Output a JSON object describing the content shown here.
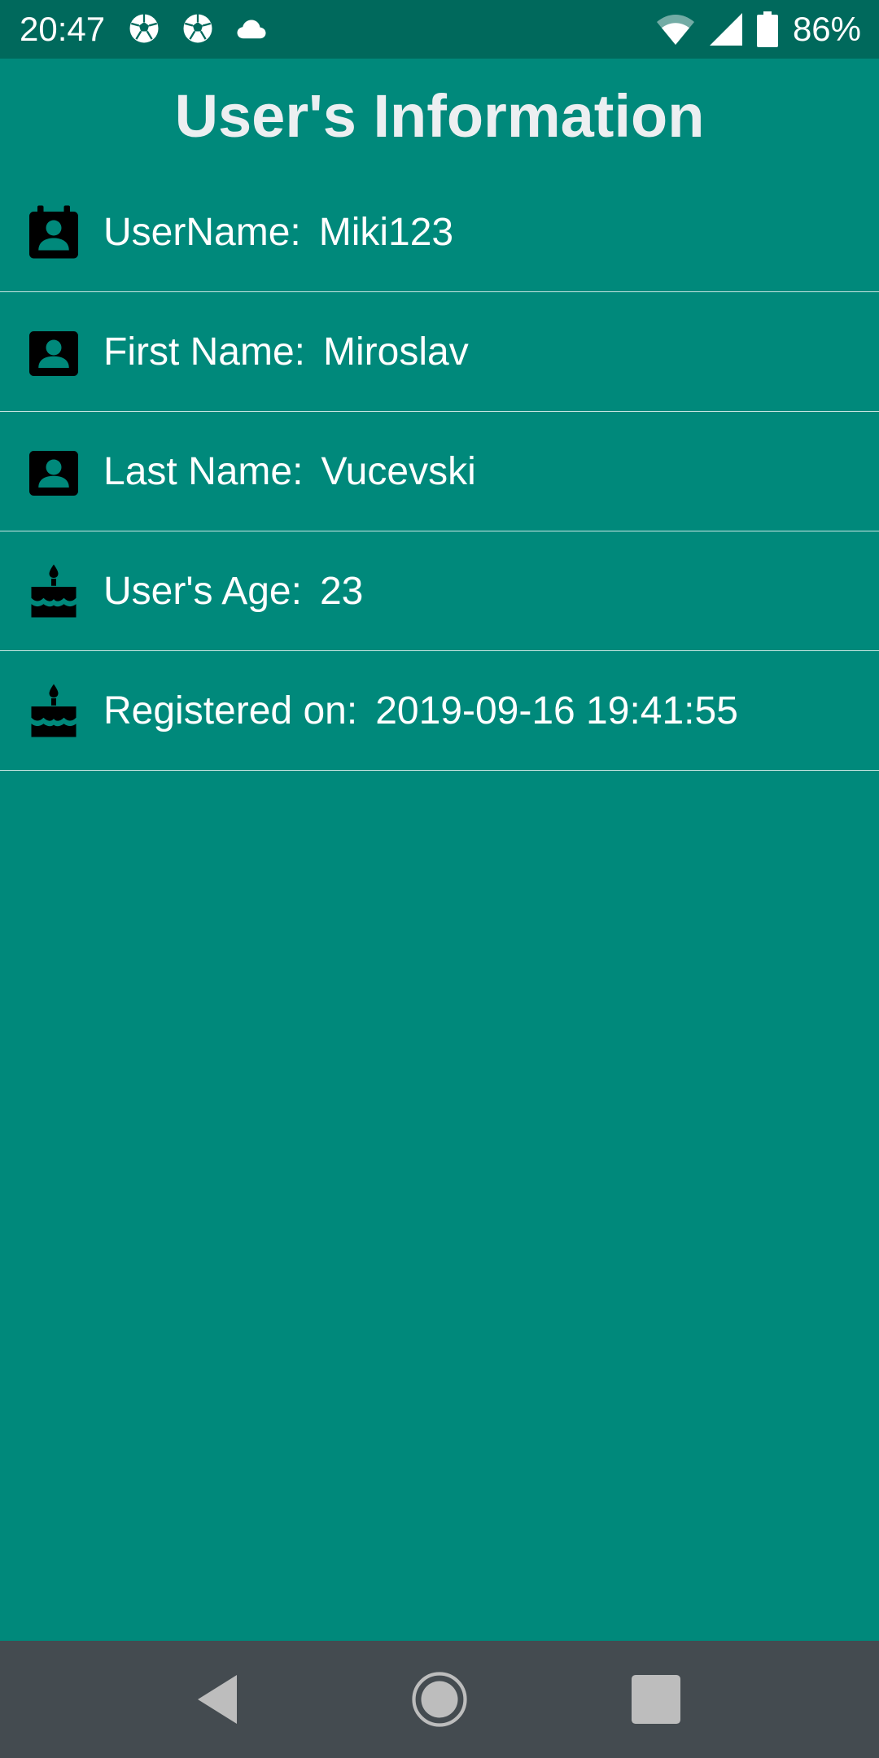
{
  "status_bar": {
    "time": "20:47",
    "notifications": [
      "soccer-ball-icon",
      "soccer-ball-icon",
      "cloud-icon"
    ],
    "battery_percent": "86%"
  },
  "header": {
    "title": "User's Information"
  },
  "rows": [
    {
      "icon": "contact-calendar-icon",
      "label": "UserName:",
      "value": "Miki123"
    },
    {
      "icon": "account-box-icon",
      "label": "First Name:",
      "value": "Miroslav"
    },
    {
      "icon": "account-box-icon",
      "label": "Last Name:",
      "value": "Vucevski"
    },
    {
      "icon": "cake-icon",
      "label": "User's Age:",
      "value": "23"
    },
    {
      "icon": "cake-icon",
      "label": "Registered on:",
      "value": "2019-09-16 19:41:55"
    }
  ],
  "colors": {
    "background": "#00897B",
    "status_bar": "#00695C",
    "nav_bar": "#444B50",
    "title_text": "#ECEFF1",
    "divider": "#C8E6E2"
  },
  "nav_bar": {
    "buttons": [
      "back-icon",
      "home-icon",
      "recents-icon"
    ]
  }
}
